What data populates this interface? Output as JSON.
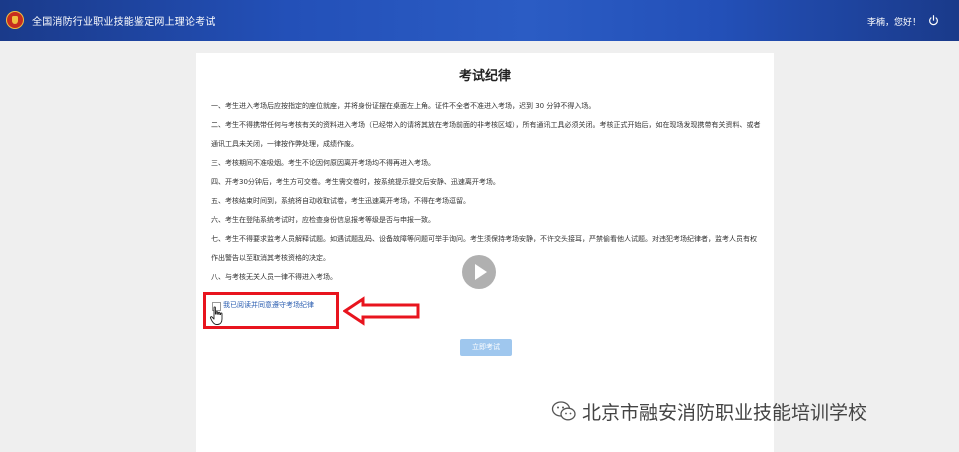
{
  "header": {
    "title": "全国消防行业职业技能鉴定网上理论考试",
    "greeting": "李楠，您好！"
  },
  "exam": {
    "title": "考试纪律",
    "rules": [
      "一、考生进入考场后应按指定的座位就座，并将身份证摆在桌面左上角。证件不全者不准进入考场，迟到 30 分钟不得入场。",
      "二、考生不得携带任何与考核有关的资料进入考场（已经带入的请将其放在考场前面的非考核区域），所有通讯工具必须关闭。考核正式开始后，如在现场发现携带有关资料、或者通讯工具未关闭，一律按作弊处理，成绩作废。",
      "三、考核期间不准吸烟。考生不论因何原因离开考场均不得再进入考场。",
      "四、开考30分钟后，考生方可交卷。考生需交卷时，按系统提示提交后安静、迅速离开考场。",
      "五、考核结束时间到，系统将自动收取试卷，考生迅速离开考场，不得在考场逗留。",
      "六、考生在登陆系统考试时，应检查身份信息报考等级是否与申报一致。",
      "七、考生不得要求监考人员解释试题。如遇试题乱码、设备故障等问题可举手询问。考生须保持考场安静，不许交头接耳，严禁偷看他人试题。对违犯考场纪律者，监考人员有权作出警告以至取消其考核资格的决定。",
      "八、与考核无关人员一律不得进入考场。"
    ],
    "agree_label": "我已阅读并同意遵守考场纪律",
    "start_label": "立即考试"
  },
  "watermark": {
    "text": "北京市融安消防职业技能培训学校"
  },
  "icons": {
    "logo": "fire-emblem-icon",
    "power": "power-icon",
    "play": "play-icon",
    "cursor": "hand-cursor-icon",
    "arrow": "left-arrow-annotation",
    "watermark": "wechat-icon"
  },
  "colors": {
    "header": "#2350b8",
    "annotation_red": "#e8141e",
    "link_blue": "#2a5db0",
    "button_disabled": "#9fc7ee"
  }
}
